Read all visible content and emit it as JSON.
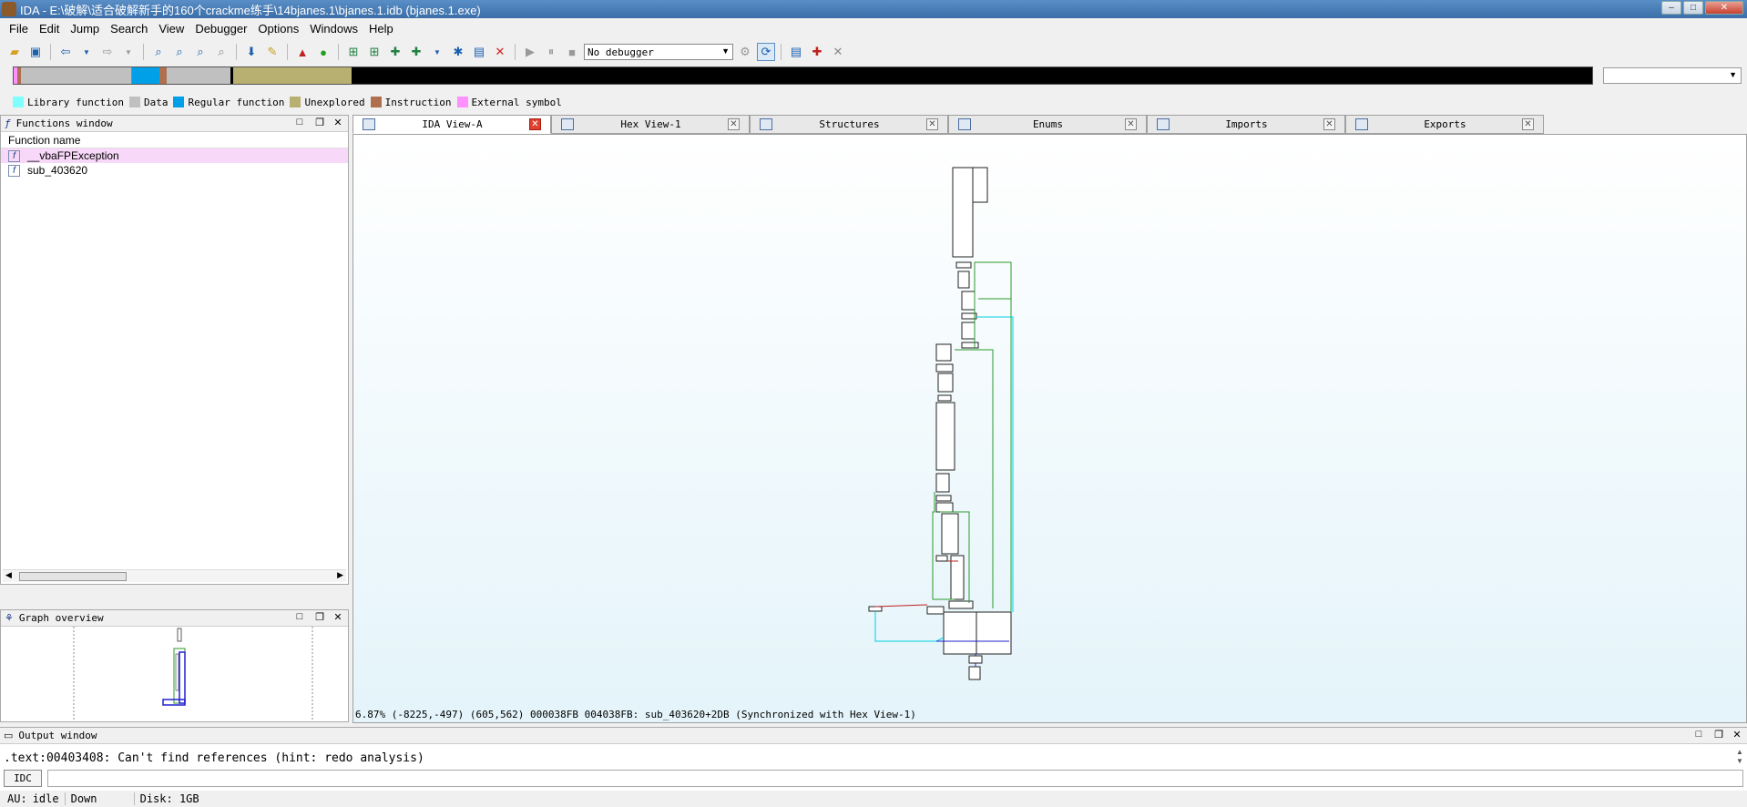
{
  "window": {
    "title": "IDA - E:\\破解\\适合破解新手的160个crackme练手\\14bjanes.1\\bjanes.1.idb (bjanes.1.exe)"
  },
  "menu": [
    "File",
    "Edit",
    "Jump",
    "Search",
    "View",
    "Debugger",
    "Options",
    "Windows",
    "Help"
  ],
  "toolbar": {
    "debugger_select": "No debugger"
  },
  "legend": [
    {
      "label": "Library function",
      "color": "#80ffff"
    },
    {
      "label": "Data",
      "color": "#c0c0c0"
    },
    {
      "label": "Regular function",
      "color": "#00a0e8"
    },
    {
      "label": "Unexplored",
      "color": "#b8b070"
    },
    {
      "label": "Instruction",
      "color": "#b07050"
    },
    {
      "label": "External symbol",
      "color": "#ff90ff"
    }
  ],
  "functions_window": {
    "title": "Functions window",
    "column": "Function name",
    "items": [
      {
        "name": "__vbaFPException",
        "library": true
      },
      {
        "name": "sub_403620",
        "library": false
      }
    ]
  },
  "graph_overview": {
    "title": "Graph overview"
  },
  "tabs": [
    {
      "label": "IDA View-A",
      "active": true,
      "icon": "ida-view-icon"
    },
    {
      "label": "Hex View-1",
      "active": false,
      "icon": "hex-view-icon"
    },
    {
      "label": "Structures",
      "active": false,
      "icon": "structures-icon"
    },
    {
      "label": "Enums",
      "active": false,
      "icon": "enums-icon"
    },
    {
      "label": "Imports",
      "active": false,
      "icon": "imports-icon"
    },
    {
      "label": "Exports",
      "active": false,
      "icon": "exports-icon"
    }
  ],
  "ida_view": {
    "status": "6.87% (-8225,-497) (605,562) 000038FB 004038FB: sub_403620+2DB (Synchronized with Hex View-1)"
  },
  "output_window": {
    "title": "Output window",
    "line": ".text:00403408: Can't find references (hint: redo analysis)"
  },
  "idc": {
    "button": "IDC"
  },
  "status_bar": {
    "au_label": "AU:",
    "au_value": "idle",
    "direction": "Down",
    "disk": "Disk: 1GB"
  }
}
